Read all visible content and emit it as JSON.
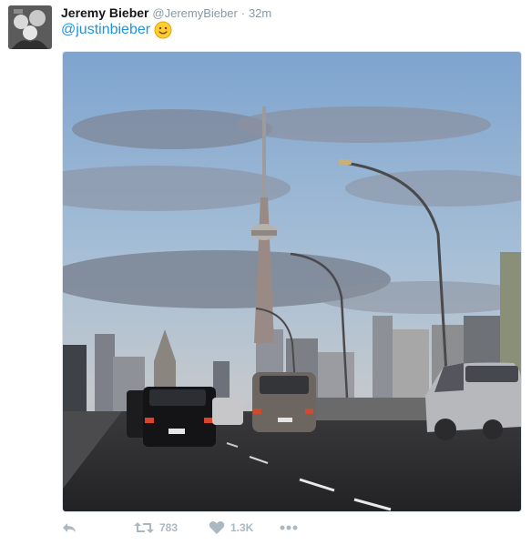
{
  "tweet": {
    "author_name": "Jeremy Bieber",
    "author_handle": "@JeremyBieber",
    "separator": "·",
    "timestamp": "32m",
    "text_mention": "@justinbieber",
    "emoji": "smile-emoji-icon"
  },
  "actions": {
    "reply_icon": "reply-icon",
    "retweet_icon": "retweet-icon",
    "retweet_count": "783",
    "like_icon": "heart-icon",
    "like_count": "1.3K",
    "more_icon": "more-dots-icon"
  },
  "colors": {
    "link": "#1b95e0",
    "muted": "#8899a6",
    "action": "#aab8c2"
  }
}
